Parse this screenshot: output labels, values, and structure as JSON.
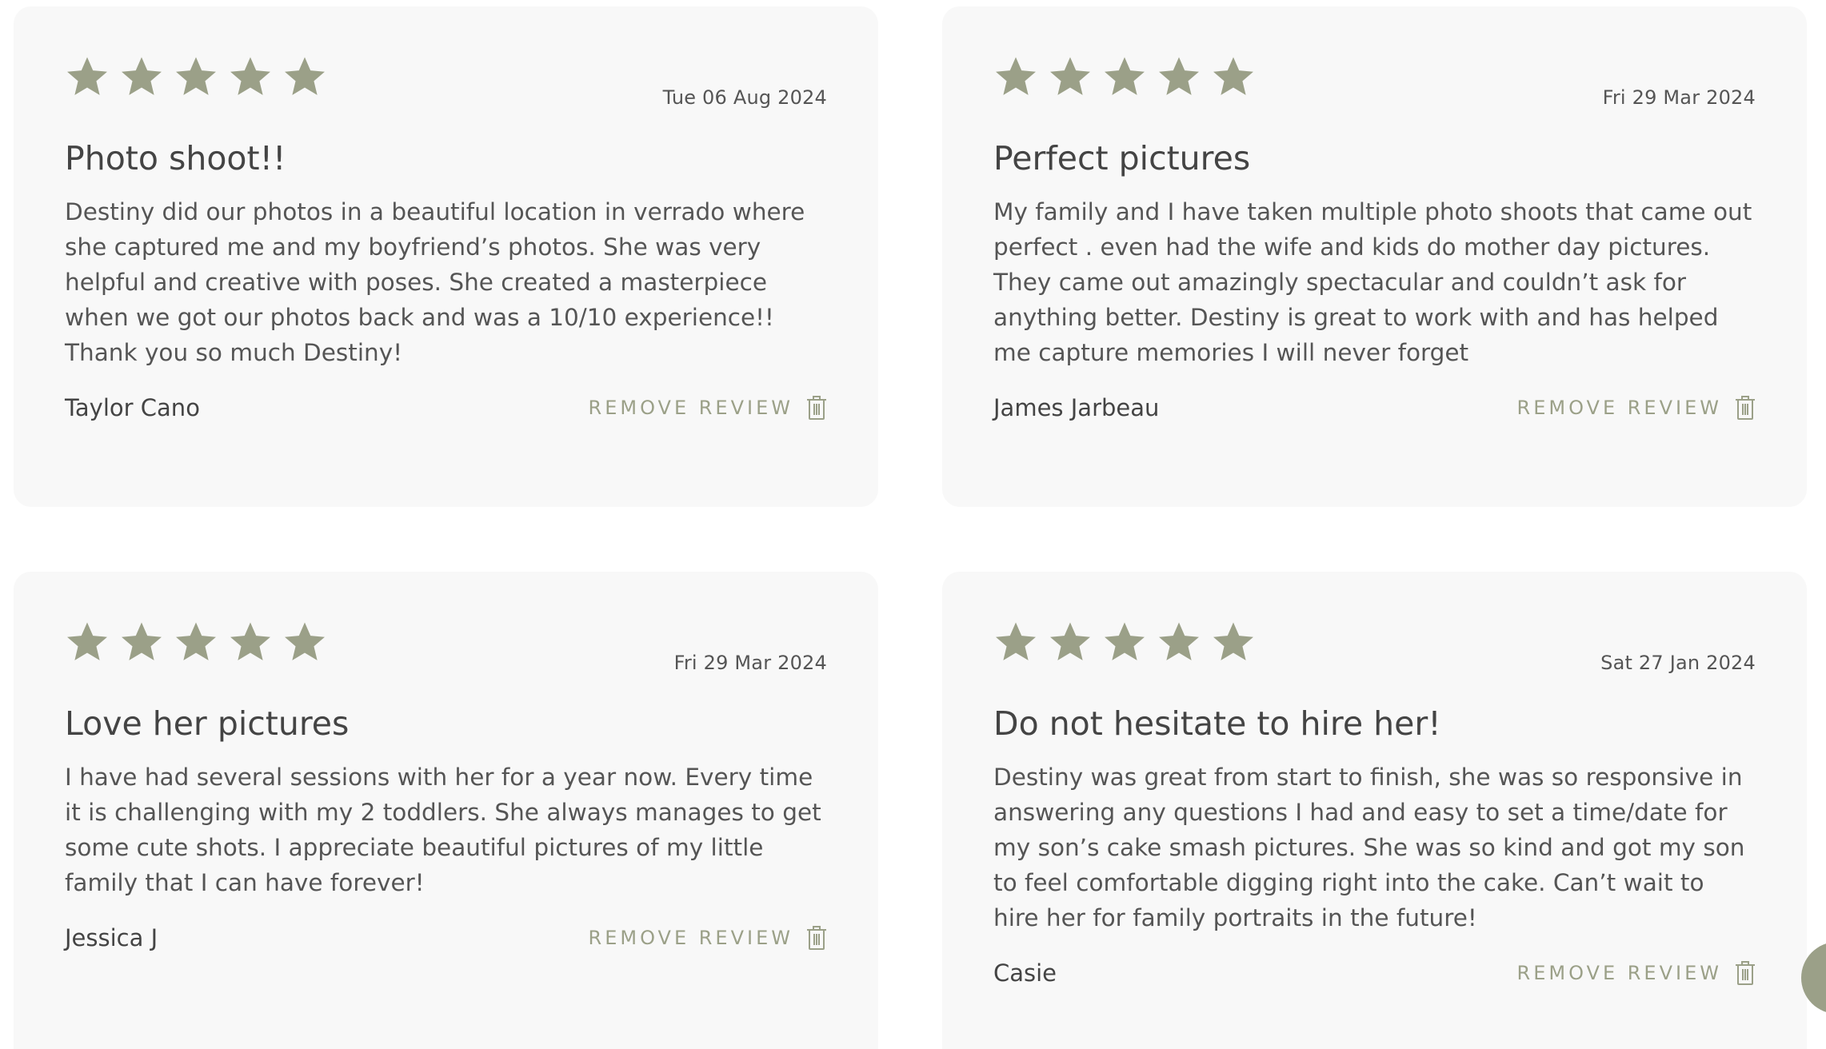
{
  "colors": {
    "accent": "#9ba088",
    "card_bg": "#f8f8f8",
    "text": "#4a4a4a"
  },
  "reviews": [
    {
      "rating": 5,
      "date": "Tue 06 Aug 2024",
      "title": "Photo shoot!!",
      "body": "Destiny did our photos in a beautiful location in verrado where she captured me and my boyfriend’s photos. She was very helpful and creative with poses. She created a masterpiece when we got our photos back and was a 10/10 experience!! Thank you so much Destiny!",
      "author": "Taylor Cano",
      "remove_label": "REMOVE REVIEW"
    },
    {
      "rating": 5,
      "date": "Fri 29 Mar 2024",
      "title": "Perfect pictures",
      "body": "My family and I have taken multiple photo shoots that came out perfect . even had the wife and kids do mother day pictures. They came out amazingly spectacular and couldn’t ask for anything better. Destiny is great to work with and has helped me capture memories I will never forget",
      "author": "James Jarbeau",
      "remove_label": "REMOVE REVIEW"
    },
    {
      "rating": 5,
      "date": "Fri 29 Mar 2024",
      "title": "Love her pictures",
      "body": "I have had several sessions with her for a year now. Every time it is challenging with my 2 toddlers. She always manages to get some cute shots. I appreciate beautiful pictures of my little family that I can have forever!",
      "author": "Jessica J",
      "remove_label": "REMOVE REVIEW"
    },
    {
      "rating": 5,
      "date": "Sat 27 Jan 2024",
      "title": "Do not hesitate to hire her!",
      "body": "Destiny was great from start to finish, she was so responsive in answering any questions I had and easy to set a time/date for my son’s cake smash pictures. She was so kind and got my son to feel comfortable digging right into the cake. Can’t wait to hire her for family portraits in the future!",
      "author": "Casie",
      "remove_label": "REMOVE REVIEW"
    }
  ],
  "icons": {
    "star": "star-icon",
    "trash": "trash-icon",
    "chat": "chat-icon"
  }
}
